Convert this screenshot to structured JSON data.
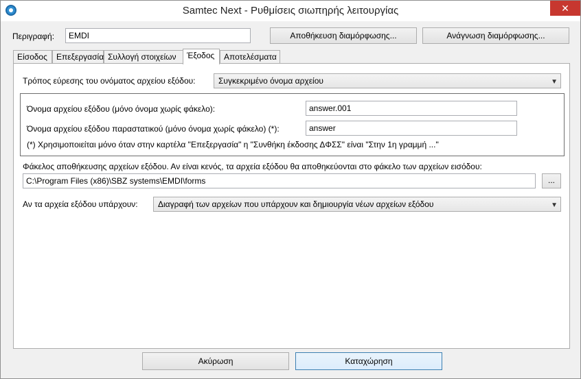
{
  "window": {
    "title": "Samtec Next - Ρυθμίσεις σιωπηρής λειτουργίας",
    "close_label": "✕"
  },
  "header": {
    "description_label": "Περιγραφή:",
    "description_value": "EMDI",
    "save_config_label": "Αποθήκευση διαμόρφωσης...",
    "load_config_label": "Ανάγνωση διαμόρφωσης..."
  },
  "tabs": [
    {
      "label": "Είσοδος"
    },
    {
      "label": "Επεξεργασία"
    },
    {
      "label": "Συλλογή στοιχείων"
    },
    {
      "label": "Έξοδος"
    },
    {
      "label": "Αποτελέσματα"
    }
  ],
  "output": {
    "filename_mode_label": "Τρόπος εύρεσης του ονόματος αρχείου εξόδου:",
    "filename_mode_value": "Συγκεκριμένο όνομα αρχείου",
    "output_name_label": "Όνομα αρχείου εξόδου (μόνο όνομα χωρίς φάκελο):",
    "output_name_value": "answer.001",
    "doc_name_label": "Όνομα αρχείου εξόδου παραστατικού (μόνο όνομα χωρίς φάκελο) (*):",
    "doc_name_value": "answer",
    "note": "(*) Χρησιμοποιείται μόνο όταν στην καρτέλα \"Επεξεργασία\" η \"Συνθήκη έκδοσης ΔΦΣΣ\" είναι \"Στην 1η γραμμή ...\"",
    "folder_label": "Φάκελος αποθήκευσης αρχείων εξόδου. Αν είναι κενός, τα αρχεία εξόδου θα αποθηκεύονται στο φάκελο των αρχείων εισόδου:",
    "folder_value": "C:\\Program Files (x86)\\SBZ systems\\EMDI\\forms",
    "browse_label": "...",
    "exists_label": "Αν τα αρχεία εξόδου υπάρχουν:",
    "exists_value": "Διαγραφή των αρχείων που υπάρχουν και δημιουργία νέων αρχείων εξόδου"
  },
  "footer": {
    "cancel_label": "Ακύρωση",
    "ok_label": "Καταχώρηση"
  }
}
